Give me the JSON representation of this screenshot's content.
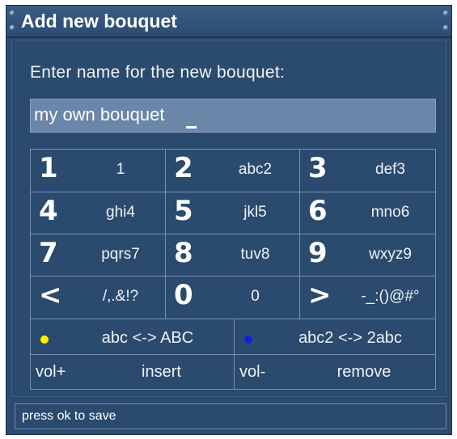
{
  "window": {
    "title": "Add new bouquet"
  },
  "prompt": "Enter name for the new bouquet:",
  "input": {
    "value": "my own bouquet"
  },
  "keypad": {
    "rows": [
      [
        {
          "digit": "1",
          "letters": "1"
        },
        {
          "digit": "2",
          "letters": "abc2"
        },
        {
          "digit": "3",
          "letters": "def3"
        }
      ],
      [
        {
          "digit": "4",
          "letters": "ghi4"
        },
        {
          "digit": "5",
          "letters": "jkl5"
        },
        {
          "digit": "6",
          "letters": "mno6"
        }
      ],
      [
        {
          "digit": "7",
          "letters": "pqrs7"
        },
        {
          "digit": "8",
          "letters": "tuv8"
        },
        {
          "digit": "9",
          "letters": "wxyz9"
        }
      ],
      [
        {
          "digit": "<",
          "letters": "/,.&!?"
        },
        {
          "digit": "0",
          "letters": "0"
        },
        {
          "digit": ">",
          "letters": "-_:()@#°"
        }
      ]
    ],
    "color_keys": [
      {
        "label": "abc <-> ABC",
        "color": "#ffee00"
      },
      {
        "label": "abc2 <-> 2abc",
        "color": "#1020e0"
      }
    ],
    "vol_keys": [
      {
        "label": "vol+",
        "action": "insert"
      },
      {
        "label": "vol-",
        "action": "remove"
      }
    ]
  },
  "status": {
    "text": "press ok to save"
  },
  "colors": {
    "background": "#2c4a6e",
    "input_bg": "#6a86a8",
    "grid_line": "#7a92b0"
  }
}
